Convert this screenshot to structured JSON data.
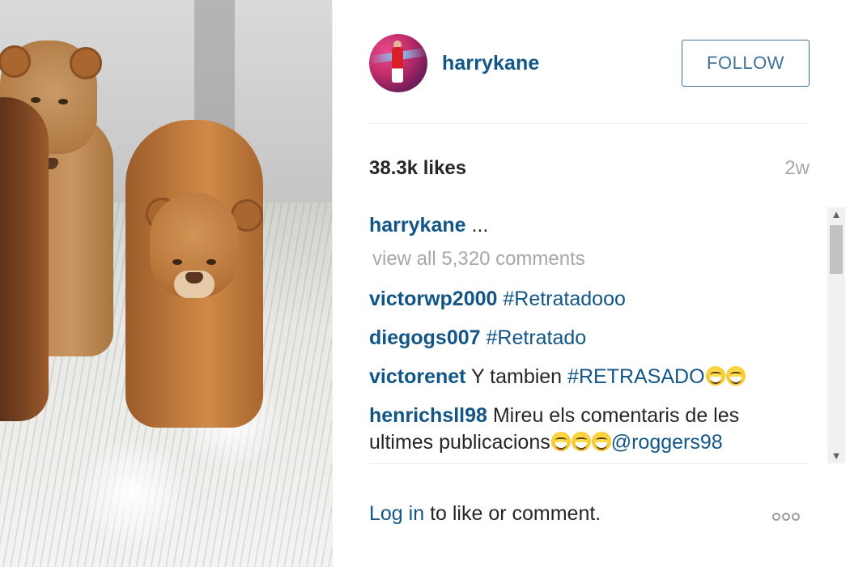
{
  "post": {
    "username": "harrykane",
    "follow_label": "FOLLOW",
    "likes": "38.3k likes",
    "time_ago": "2w"
  },
  "caption": {
    "user": "harrykane",
    "text": " ..."
  },
  "view_all_comments": "view all 5,320 comments",
  "comments": [
    {
      "user": "victorwp2000",
      "text": " ",
      "tag": "#Retratadooo"
    },
    {
      "user": "diegogs007",
      "text": " ",
      "tag": "#Retratado"
    },
    {
      "user": "victorenet",
      "text": " Y tambien ",
      "tag": "#RETRASADO"
    },
    {
      "user": "henrichsll98",
      "text": " Mireu els comentaris de les ultimes publicacions",
      "tag": "@roggers98"
    }
  ],
  "footer": {
    "login_link": "Log in",
    "login_rest": " to like or comment."
  },
  "icons": {
    "more": "more-options-icon",
    "scroll_up": "scroll-up-arrow-icon",
    "scroll_down": "scroll-down-arrow-icon",
    "emoji": "laughing-emoji-icon"
  },
  "colors": {
    "link_blue": "#125688",
    "follow_blue": "#3f729b",
    "muted_gray": "#a5a7aa",
    "text_dark": "#262626"
  }
}
